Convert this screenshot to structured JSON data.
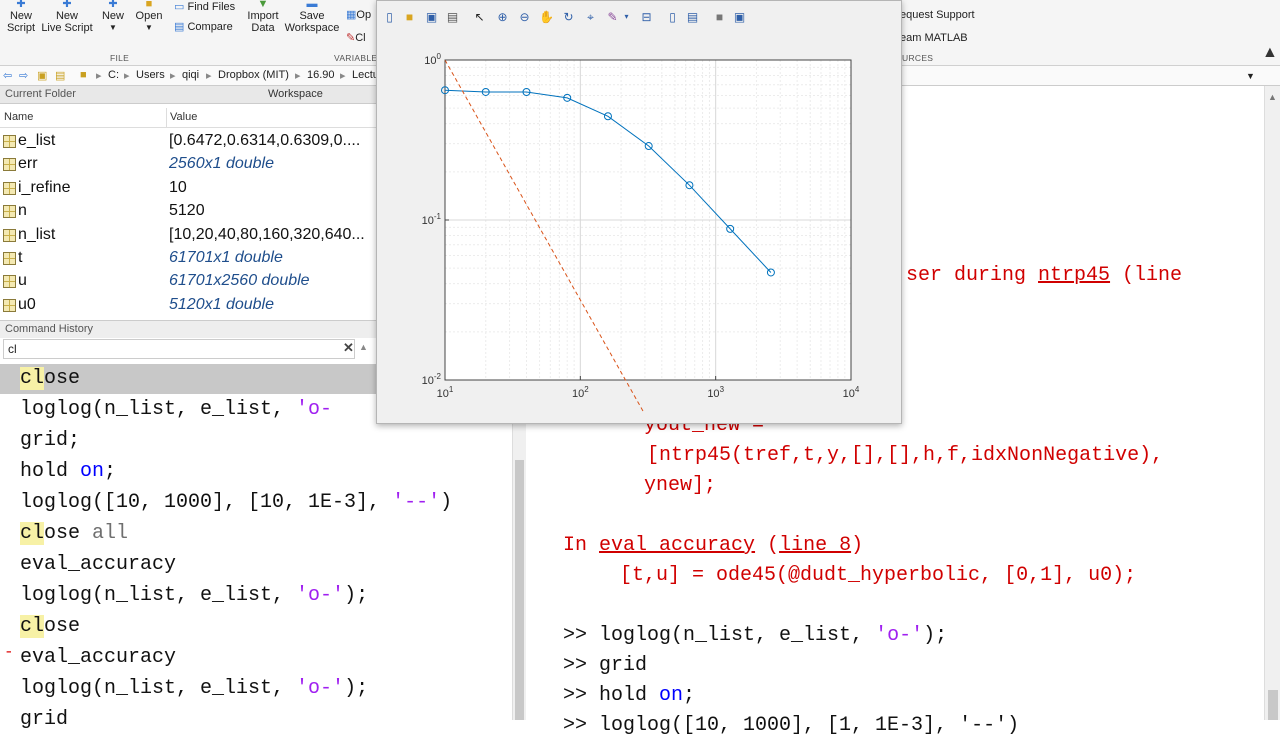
{
  "toolstrip": {
    "buttons": [
      {
        "label": "New\nScript"
      },
      {
        "label": "New\nLive Script"
      },
      {
        "label": "New"
      },
      {
        "label": "Open"
      },
      {
        "label": "Find Files"
      },
      {
        "label": "Compare"
      },
      {
        "label": "Import\nData"
      },
      {
        "label": "Save\nWorkspace"
      },
      {
        "label": "Op"
      },
      {
        "label": "Cl"
      },
      {
        "label": "equest Support"
      },
      {
        "label": "eam MATLAB"
      }
    ],
    "sections": [
      "FILE",
      "VARIABLE",
      "URCES"
    ]
  },
  "address": {
    "segments": [
      "C:",
      "Users",
      "qiqi",
      "Dropbox (MIT)",
      "16.90",
      "Lectu"
    ]
  },
  "panels": {
    "current_folder": "Current Folder",
    "workspace": "Workspace",
    "command_history": "Command History"
  },
  "workspace": {
    "col_name": "Name",
    "col_value": "Value",
    "rows": [
      {
        "name": "e_list",
        "value": "[0.6472,0.6314,0.6309,0....",
        "italic": false
      },
      {
        "name": "err",
        "value": "2560x1 double",
        "italic": true
      },
      {
        "name": "i_refine",
        "value": "10",
        "italic": false
      },
      {
        "name": "n",
        "value": "5120",
        "italic": false
      },
      {
        "name": "n_list",
        "value": "[10,20,40,80,160,320,640...",
        "italic": false
      },
      {
        "name": "t",
        "value": "61701x1 double",
        "italic": true
      },
      {
        "name": "u",
        "value": "61701x2560 double",
        "italic": true
      },
      {
        "name": "u0",
        "value": "5120x1 double",
        "italic": true
      }
    ]
  },
  "history": {
    "search_value": "cl",
    "lines": [
      [
        {
          "t": "cl",
          "c": "hl"
        },
        {
          "t": "ose",
          "c": ""
        }
      ],
      [
        {
          "t": "loglog(n_list, e_list, ",
          "c": ""
        },
        {
          "t": "'o-",
          "c": "str"
        }
      ],
      [
        {
          "t": "grid;",
          "c": ""
        }
      ],
      [
        {
          "t": "hold ",
          "c": ""
        },
        {
          "t": "on",
          "c": "kw"
        },
        {
          "t": ";",
          "c": ""
        }
      ],
      [
        {
          "t": "loglog([10, 1000], [10, 1E-3], ",
          "c": ""
        },
        {
          "t": "'--'",
          "c": "str"
        },
        {
          "t": ")",
          "c": ""
        }
      ],
      [
        {
          "t": "cl",
          "c": "hl"
        },
        {
          "t": "ose ",
          "c": ""
        },
        {
          "t": "all",
          "c": "kwp"
        }
      ],
      [
        {
          "t": "eval_accuracy",
          "c": ""
        }
      ],
      [
        {
          "t": "loglog(n_list, e_list, ",
          "c": ""
        },
        {
          "t": "'o-'",
          "c": "str"
        },
        {
          "t": ");",
          "c": ""
        }
      ],
      [
        {
          "t": "cl",
          "c": "hl"
        },
        {
          "t": "ose",
          "c": ""
        }
      ],
      [
        {
          "t": "eval_accuracy",
          "c": ""
        }
      ],
      [
        {
          "t": "loglog(n_list, e_list, ",
          "c": ""
        },
        {
          "t": "'o-'",
          "c": "str"
        },
        {
          "t": ");",
          "c": ""
        }
      ],
      [
        {
          "t": "grid",
          "c": ""
        }
      ]
    ]
  },
  "command_window": {
    "lines": [
      [
        {
          "t": "ser during ",
          "c": "red"
        },
        {
          "t": "ntrp45",
          "c": "redu"
        },
        {
          "t": " (line",
          "c": "red"
        }
      ],
      [
        {
          "t": "yout_new =",
          "c": "red"
        }
      ],
      [
        {
          "t": "[ntrp45(tref,t,y,[],[],h,f,idxNonNegative),",
          "c": "red"
        }
      ],
      [
        {
          "t": "ynew];",
          "c": "red"
        }
      ],
      [
        {
          "t": "In ",
          "c": "red"
        },
        {
          "t": "eval_accuracy",
          "c": "redu"
        },
        {
          "t": " (",
          "c": "red"
        },
        {
          "t": "line 8",
          "c": "redu"
        },
        {
          "t": ")",
          "c": "red"
        }
      ],
      [
        {
          "t": "[t,u] = ode45(@dudt_hyperbolic, [0,1], u0);",
          "c": "red"
        }
      ],
      [
        {
          "t": ">> loglog(n_list, e_list, ",
          "c": ""
        },
        {
          "t": "'o-'",
          "c": "str"
        },
        {
          "t": ");",
          "c": ""
        }
      ],
      [
        {
          "t": ">> grid",
          "c": ""
        }
      ],
      [
        {
          "t": ">> hold ",
          "c": ""
        },
        {
          "t": "on",
          "c": "kw"
        },
        {
          "t": ";",
          "c": ""
        }
      ],
      [
        {
          "t": ">> loglog([10, 1000], [1, 1E-3], '--')",
          "c": ""
        }
      ]
    ]
  },
  "chart_data": {
    "type": "line",
    "xscale": "log",
    "yscale": "log",
    "xlim": [
      10,
      10000
    ],
    "ylim": [
      0.01,
      1
    ],
    "grid": true,
    "xticks": [
      {
        "b": "10",
        "e": "1"
      },
      {
        "b": "10",
        "e": "2"
      },
      {
        "b": "10",
        "e": "3"
      },
      {
        "b": "10",
        "e": "4"
      }
    ],
    "yticks": [
      {
        "b": "10",
        "e": "-2"
      },
      {
        "b": "10",
        "e": "-1"
      },
      {
        "b": "10",
        "e": "0"
      }
    ],
    "series": [
      {
        "style": "o-",
        "color": "#0072bd",
        "x": [
          10,
          20,
          40,
          80,
          160,
          320,
          640,
          1280,
          2560
        ],
        "y": [
          0.6472,
          0.6314,
          0.6309,
          0.58,
          0.445,
          0.29,
          0.165,
          0.088,
          0.047
        ]
      },
      {
        "style": "--",
        "color": "#d95319",
        "x": [
          10,
          1000
        ],
        "y": [
          1,
          0.001
        ]
      }
    ]
  }
}
